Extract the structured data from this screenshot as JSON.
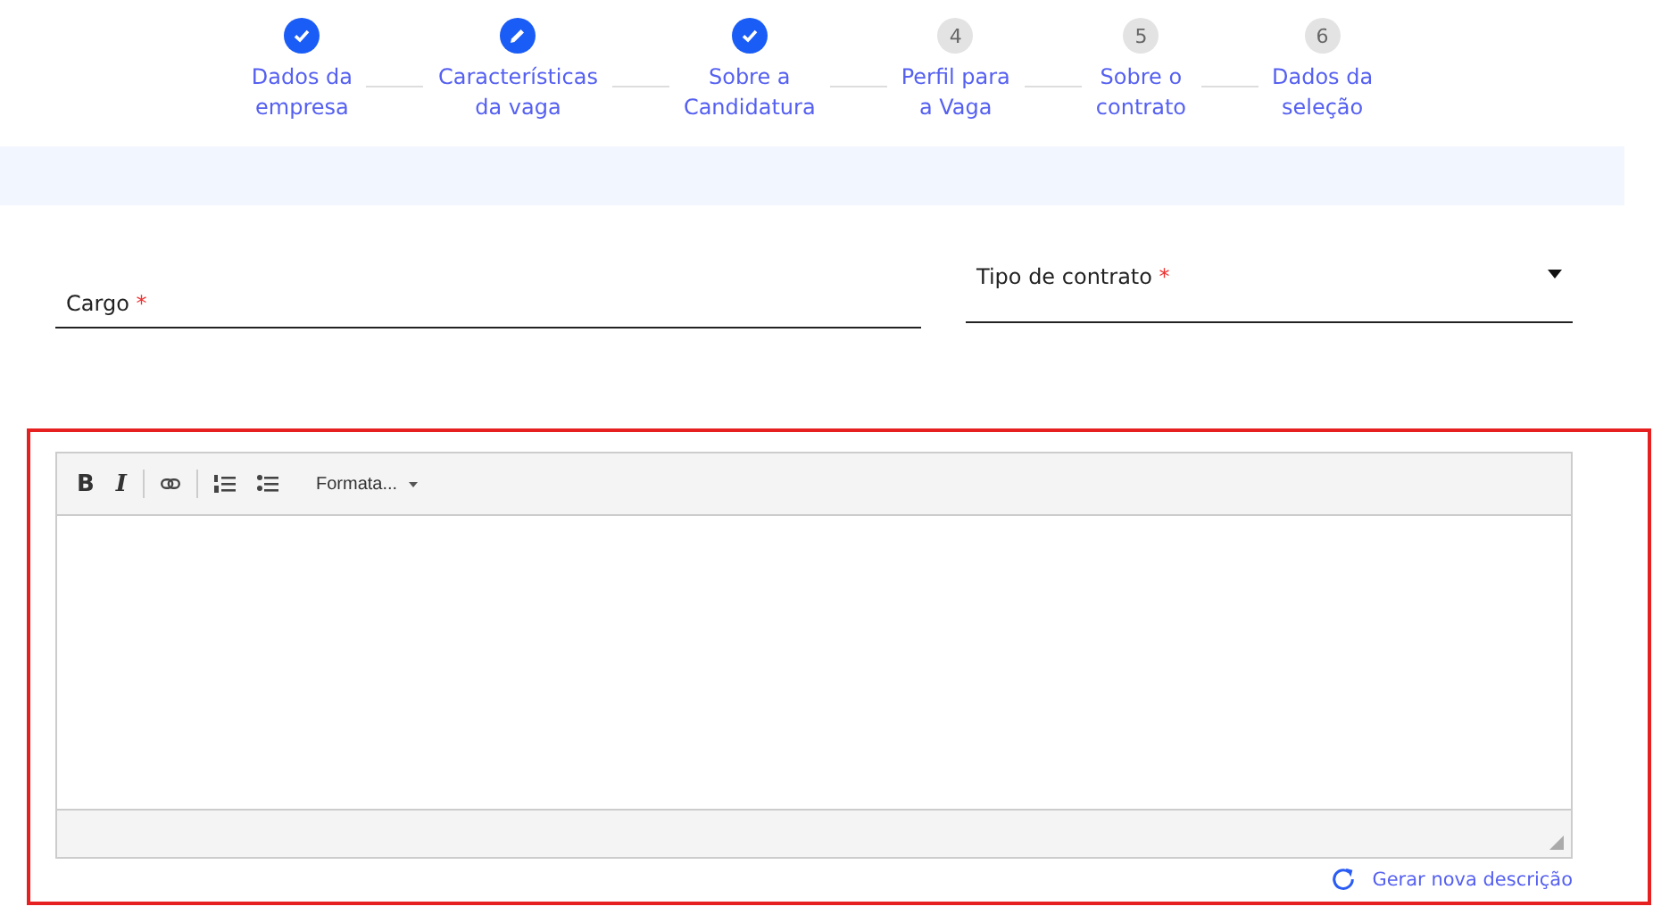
{
  "steps": [
    {
      "kind": "done",
      "label": [
        "Dados da",
        "empresa"
      ]
    },
    {
      "kind": "current",
      "label": [
        "Características",
        "da vaga"
      ]
    },
    {
      "kind": "done",
      "label": [
        "Sobre a",
        "Candidatura"
      ]
    },
    {
      "kind": "pending",
      "number": "4",
      "label": [
        "Perfil para",
        "a Vaga"
      ]
    },
    {
      "kind": "pending",
      "number": "5",
      "label": [
        "Sobre o",
        "contrato"
      ]
    },
    {
      "kind": "pending",
      "number": "6",
      "label": [
        "Dados da",
        "seleção"
      ]
    }
  ],
  "fields": [
    {
      "kind": "text",
      "label": "Cargo",
      "required": "*"
    },
    {
      "kind": "select",
      "label": "Tipo de contrato",
      "required": "*"
    }
  ],
  "editor": {
    "bold": "B",
    "italic": "I",
    "format": "Formata..."
  },
  "regenerate": "Gerar nova descrição"
}
